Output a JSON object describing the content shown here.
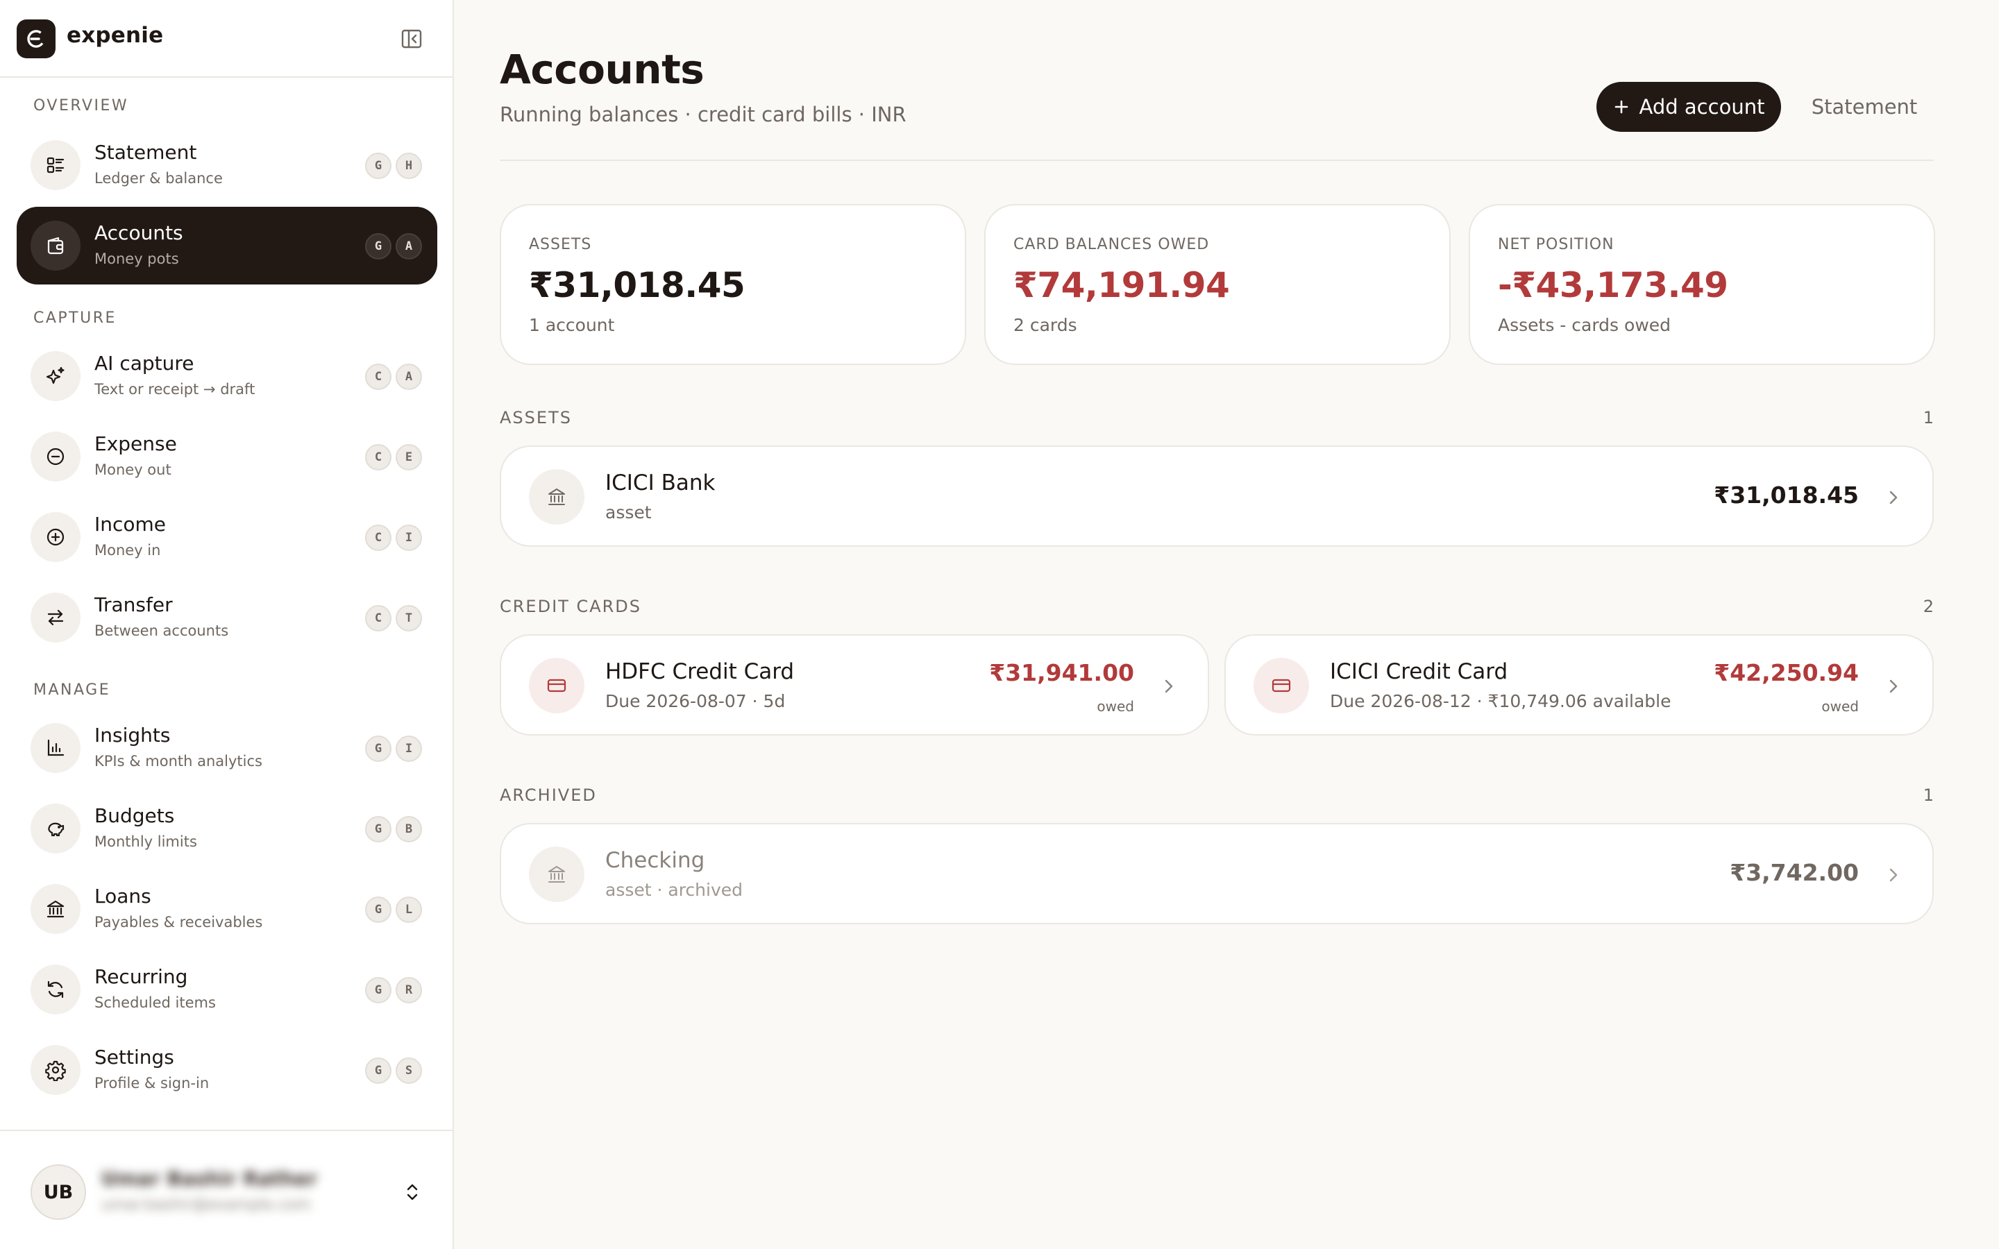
{
  "app": {
    "name": "expenie"
  },
  "sidebar": {
    "sections": {
      "overview": "OVERVIEW",
      "capture": "CAPTURE",
      "manage": "MANAGE"
    },
    "items": [
      {
        "title": "Statement",
        "subtitle": "Ledger & balance",
        "keys": [
          "G",
          "H"
        ],
        "icon": "list-icon"
      },
      {
        "title": "Accounts",
        "subtitle": "Money pots",
        "keys": [
          "G",
          "A"
        ],
        "icon": "wallet-icon",
        "active": true
      },
      {
        "title": "AI capture",
        "subtitle": "Text or receipt → draft",
        "keys": [
          "C",
          "A"
        ],
        "icon": "sparkles-icon"
      },
      {
        "title": "Expense",
        "subtitle": "Money out",
        "keys": [
          "C",
          "E"
        ],
        "icon": "minus-circle-icon"
      },
      {
        "title": "Income",
        "subtitle": "Money in",
        "keys": [
          "C",
          "I"
        ],
        "icon": "plus-circle-icon"
      },
      {
        "title": "Transfer",
        "subtitle": "Between accounts",
        "keys": [
          "C",
          "T"
        ],
        "icon": "arrows-swap-icon"
      },
      {
        "title": "Insights",
        "subtitle": "KPIs & month analytics",
        "keys": [
          "G",
          "I"
        ],
        "icon": "bar-chart-icon"
      },
      {
        "title": "Budgets",
        "subtitle": "Monthly limits",
        "keys": [
          "G",
          "B"
        ],
        "icon": "piggy-bank-icon"
      },
      {
        "title": "Loans",
        "subtitle": "Payables & receivables",
        "keys": [
          "G",
          "L"
        ],
        "icon": "bank-icon"
      },
      {
        "title": "Recurring",
        "subtitle": "Scheduled items",
        "keys": [
          "G",
          "R"
        ],
        "icon": "refresh-icon"
      },
      {
        "title": "Settings",
        "subtitle": "Profile & sign-in",
        "keys": [
          "G",
          "S"
        ],
        "icon": "gear-icon"
      }
    ],
    "user": {
      "initials": "UB",
      "name": "Umar Bashir Rather",
      "email": "umar.bashir@example.com"
    }
  },
  "header": {
    "title": "Accounts",
    "subtitle": "Running balances · credit card bills · INR",
    "add_button": "Add account",
    "statement_button": "Statement"
  },
  "summary": [
    {
      "label": "ASSETS",
      "value": "₹31,018.45",
      "note": "1 account",
      "negative": false
    },
    {
      "label": "CARD BALANCES OWED",
      "value": "₹74,191.94",
      "note": "2 cards",
      "negative": true
    },
    {
      "label": "NET POSITION",
      "value": "-₹43,173.49",
      "note": "Assets - cards owed",
      "negative": true
    }
  ],
  "groups": {
    "assets": {
      "title": "ASSETS",
      "count": "1",
      "accounts": [
        {
          "name": "ICICI Bank",
          "meta": "asset",
          "amount": "₹31,018.45",
          "icon": "bank-icon"
        }
      ]
    },
    "credit_cards": {
      "title": "CREDIT CARDS",
      "count": "2",
      "accounts": [
        {
          "name": "HDFC Credit Card",
          "meta": "Due 2026-08-07 · 5d",
          "amount": "₹31,941.00",
          "owed_label": "owed",
          "icon": "credit-card-icon"
        },
        {
          "name": "ICICI Credit Card",
          "meta": "Due 2026-08-12 · ₹10,749.06 available",
          "amount": "₹42,250.94",
          "owed_label": "owed",
          "icon": "credit-card-icon"
        }
      ]
    },
    "archived": {
      "title": "ARCHIVED",
      "count": "1",
      "accounts": [
        {
          "name": "Checking",
          "meta": "asset · archived",
          "amount": "₹3,742.00",
          "icon": "bank-icon"
        }
      ]
    }
  },
  "colors": {
    "accent_dark": "#221915",
    "negative": "#b23a3a",
    "background": "#faf9f6",
    "muted_text": "#6f6760"
  }
}
